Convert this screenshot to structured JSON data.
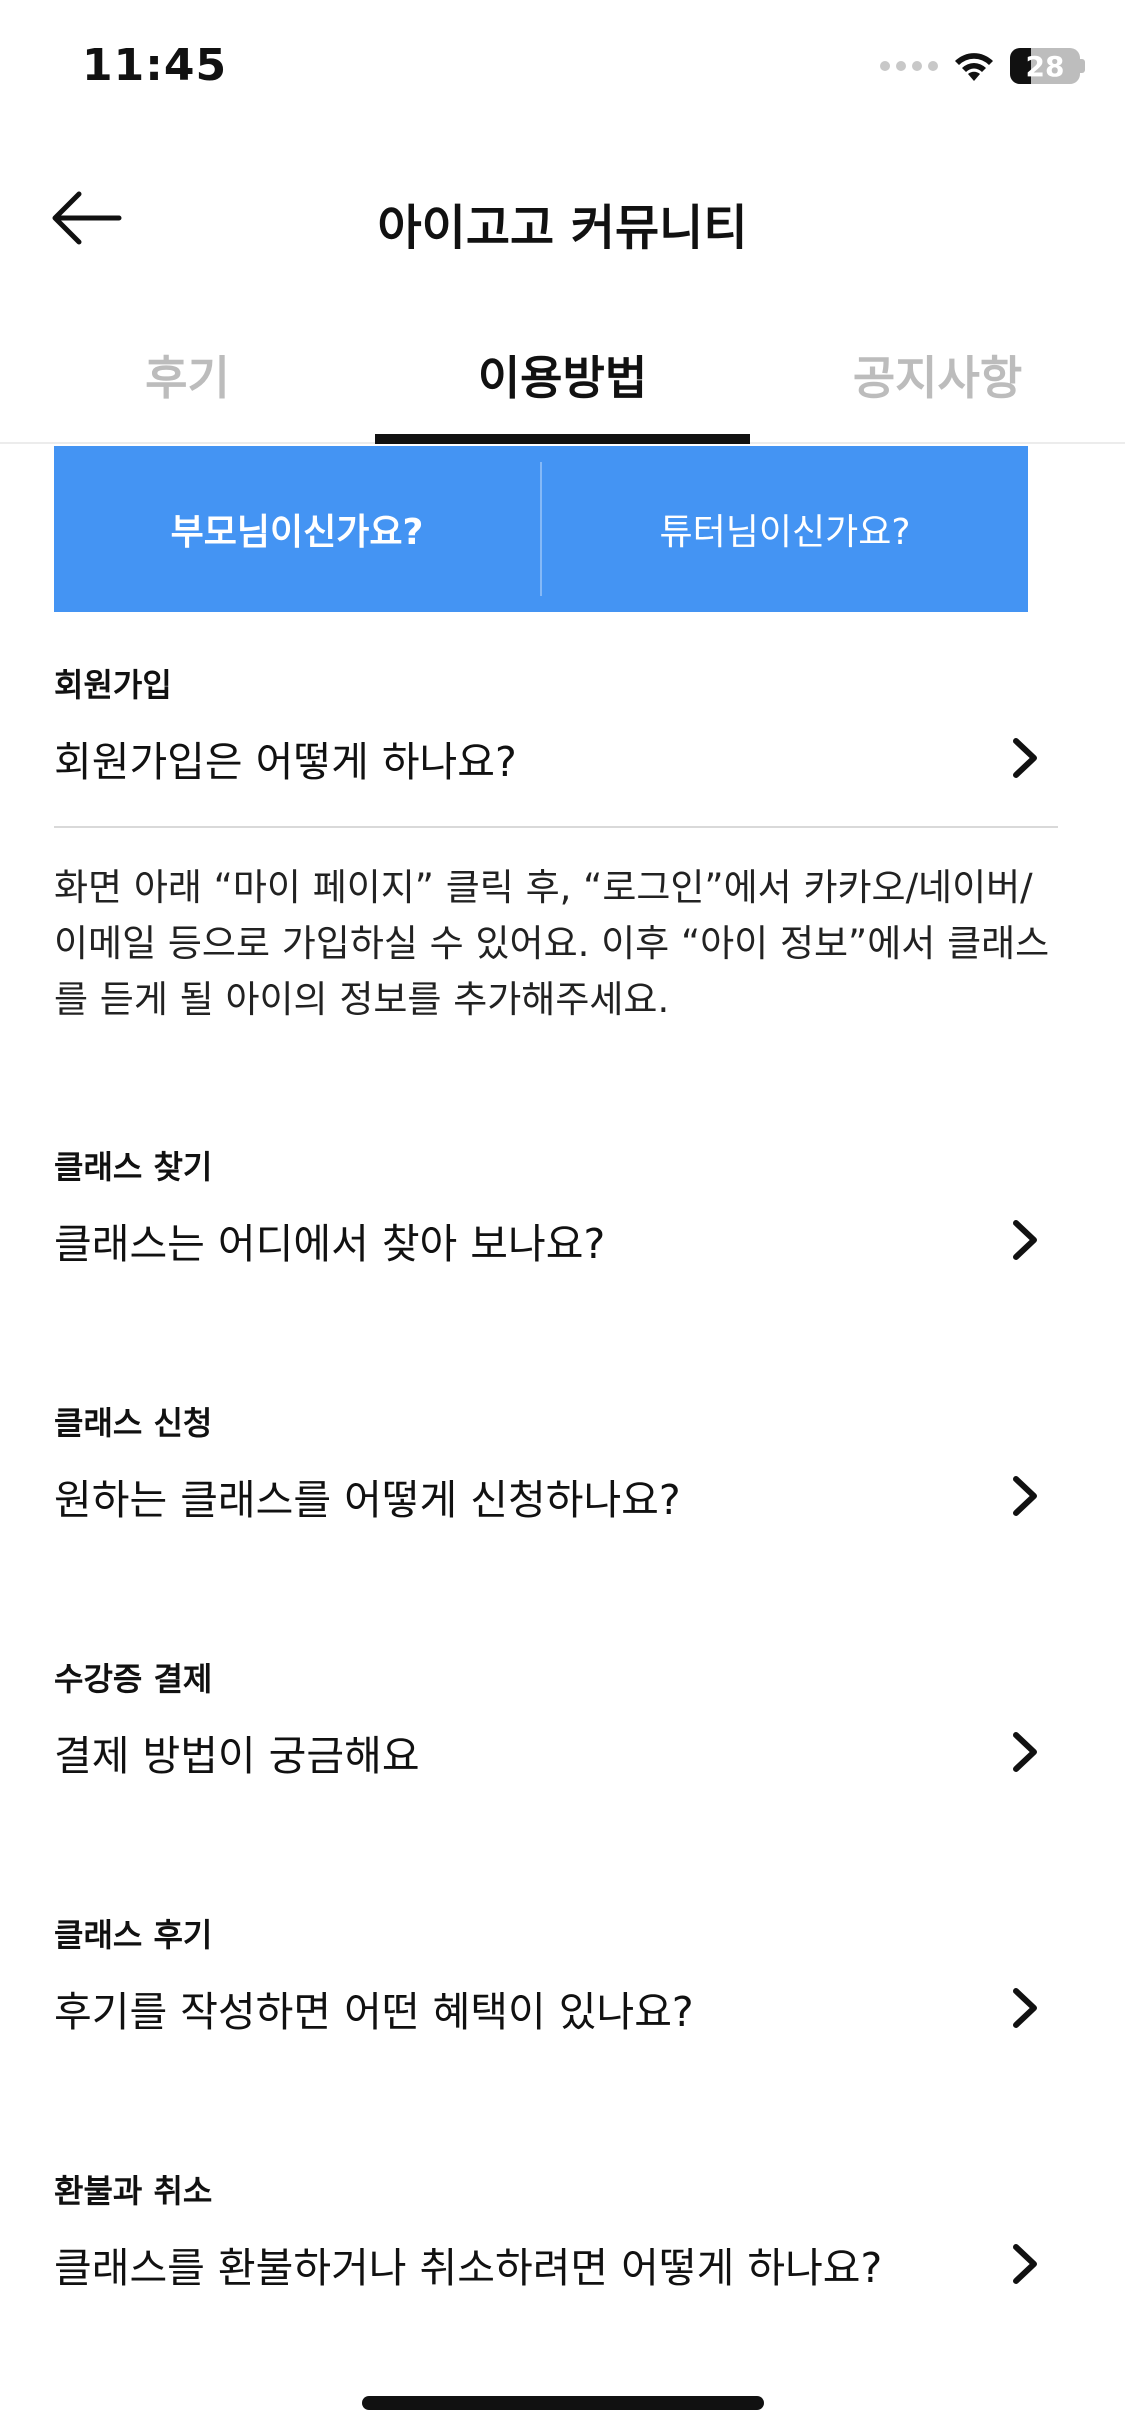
{
  "status_bar": {
    "time": "11:45",
    "battery": "28"
  },
  "header": {
    "title": "아이고고 커뮤니티"
  },
  "tabs": [
    {
      "label": "후기",
      "active": false
    },
    {
      "label": "이용방법",
      "active": true
    },
    {
      "label": "공지사항",
      "active": false
    }
  ],
  "role_selector": {
    "parent": "부모님이신가요?",
    "tutor": "튜터님이신가요?",
    "selected": "parent"
  },
  "faq": [
    {
      "category": "회원가입",
      "question": "회원가입은 어떻게 하나요?",
      "expanded": true,
      "answer": "화면 아래 “마이 페이지” 클릭 후, “로그인”에서 카카오/네이버/이메일 등으로 가입하실 수 있어요. 이후 “아이 정보”에서 클래스를 듣게 될 아이의 정보를 추가해주세요."
    },
    {
      "category": "클래스 찾기",
      "question": "클래스는 어디에서 찾아 보나요?",
      "expanded": false
    },
    {
      "category": "클래스 신청",
      "question": "원하는 클래스를 어떻게 신청하나요?",
      "expanded": false
    },
    {
      "category": "수강증 결제",
      "question": "결제 방법이 궁금해요",
      "expanded": false
    },
    {
      "category": "클래스 후기",
      "question": "후기를 작성하면 어떤 혜택이 있나요?",
      "expanded": false
    },
    {
      "category": "환불과 취소",
      "question": "클래스를 환불하거나 취소하려면 어떻게 하나요?",
      "expanded": false
    }
  ],
  "icons": {
    "back": "arrow-left-icon",
    "chevron": "chevron-right-icon",
    "wifi": "wifi-icon"
  }
}
